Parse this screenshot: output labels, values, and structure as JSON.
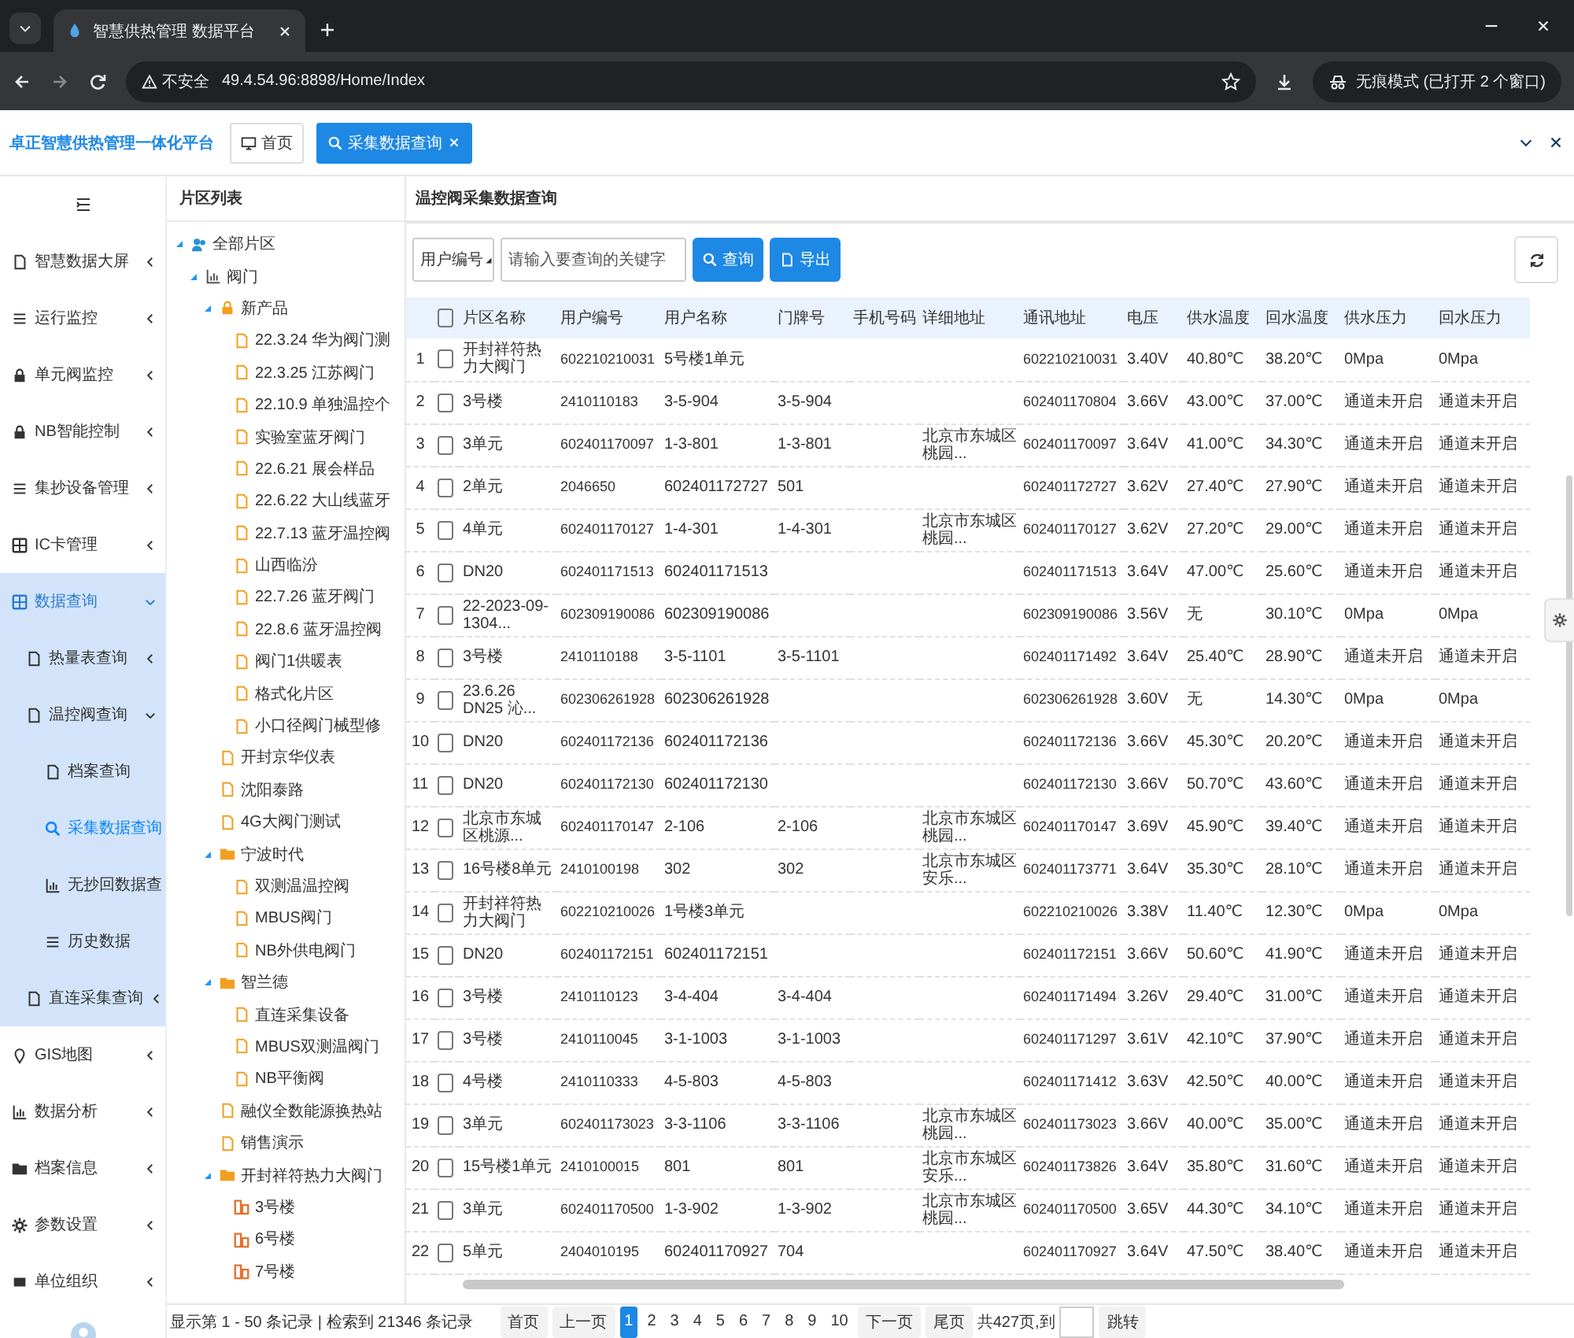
{
  "browser": {
    "tab_title": "智慧供热管理 数据平台",
    "security_label": "不安全",
    "url": "49.4.54.96:8898/Home/Index",
    "profile_label": "无痕模式 (已打开 2 个窗口)"
  },
  "app_header": {
    "brand": "卓正智慧供热管理一体化平台",
    "tabs": [
      {
        "label": "首页",
        "selected": false,
        "closable": false
      },
      {
        "label": "采集数据查询",
        "selected": true,
        "closable": true
      }
    ]
  },
  "sidebar": {
    "items": [
      {
        "label": "智慧数据大屏",
        "selected": false,
        "expanded": false
      },
      {
        "label": "运行监控",
        "selected": false,
        "expanded": false
      },
      {
        "label": "单元阀监控",
        "selected": false,
        "expanded": false
      },
      {
        "label": "NB智能控制",
        "selected": false,
        "expanded": false
      },
      {
        "label": "集抄设备管理",
        "selected": false,
        "expanded": false
      },
      {
        "label": "IC卡管理",
        "selected": false,
        "expanded": false
      },
      {
        "label": "数据查询",
        "selected": false,
        "expanded": true,
        "children": [
          {
            "label": "热量表查询",
            "selected": false,
            "expanded": false
          },
          {
            "label": "温控阀查询",
            "selected": false,
            "expanded": true,
            "children": [
              {
                "label": "档案查询",
                "selected": false
              },
              {
                "label": "采集数据查询",
                "selected": true
              },
              {
                "label": "无抄回数据查",
                "selected": false
              },
              {
                "label": "历史数据",
                "selected": false
              }
            ]
          },
          {
            "label": "直连采集查询",
            "selected": false,
            "expanded": false
          }
        ]
      },
      {
        "label": "GIS地图",
        "selected": false,
        "expanded": false
      },
      {
        "label": "数据分析",
        "selected": false,
        "expanded": false
      },
      {
        "label": "档案信息",
        "selected": false,
        "expanded": false
      },
      {
        "label": "参数设置",
        "selected": false,
        "expanded": false
      },
      {
        "label": "单位组织",
        "selected": false,
        "expanded": false
      }
    ]
  },
  "tree": {
    "title": "片区列表",
    "nodes": [
      {
        "label": "全部片区",
        "kind": "root",
        "expanded": true,
        "children": [
          {
            "label": "阀门",
            "kind": "group",
            "expanded": true,
            "children": [
              {
                "label": "新产品",
                "kind": "locked",
                "expanded": true,
                "children": [
                  {
                    "label": "22.3.24 华为阀门测",
                    "kind": "leaf"
                  },
                  {
                    "label": "22.3.25 江苏阀门",
                    "kind": "leaf"
                  },
                  {
                    "label": "22.10.9 单独温控个",
                    "kind": "leaf"
                  },
                  {
                    "label": "实验室蓝牙阀门",
                    "kind": "leaf"
                  },
                  {
                    "label": "22.6.21 展会样品",
                    "kind": "leaf"
                  },
                  {
                    "label": "22.6.22 大山线蓝牙",
                    "kind": "leaf"
                  },
                  {
                    "label": "22.7.13 蓝牙温控阀",
                    "kind": "leaf"
                  },
                  {
                    "label": "山西临汾",
                    "kind": "leaf"
                  },
                  {
                    "label": "22.7.26 蓝牙阀门",
                    "kind": "leaf"
                  },
                  {
                    "label": "22.8.6 蓝牙温控阀",
                    "kind": "leaf"
                  },
                  {
                    "label": "阀门1供暖表",
                    "kind": "leaf"
                  },
                  {
                    "label": "格式化片区",
                    "kind": "leaf"
                  },
                  {
                    "label": "小口径阀门械型修",
                    "kind": "leaf"
                  }
                ]
              },
              {
                "label": "开封京华仪表",
                "kind": "leaf"
              },
              {
                "label": "沈阳泰路",
                "kind": "leaf"
              },
              {
                "label": "4G大阀门测试",
                "kind": "leaf"
              },
              {
                "label": "宁波时代",
                "kind": "folder",
                "expanded": true,
                "children": [
                  {
                    "label": "双测温温控阀",
                    "kind": "leaf"
                  },
                  {
                    "label": "MBUS阀门",
                    "kind": "leaf"
                  },
                  {
                    "label": "NB外供电阀门",
                    "kind": "leaf"
                  }
                ]
              },
              {
                "label": "智兰德",
                "kind": "folder",
                "expanded": true,
                "children": [
                  {
                    "label": "直连采集设备",
                    "kind": "leaf"
                  },
                  {
                    "label": "MBUS双测温阀门",
                    "kind": "leaf"
                  },
                  {
                    "label": "NB平衡阀",
                    "kind": "leaf"
                  }
                ]
              },
              {
                "label": "融仪全数能源换热站",
                "kind": "leaf"
              },
              {
                "label": "销售演示",
                "kind": "leaf"
              },
              {
                "label": "开封祥符热力大阀门",
                "kind": "folder",
                "expanded": true,
                "children": [
                  {
                    "label": "3号楼",
                    "kind": "building"
                  },
                  {
                    "label": "6号楼",
                    "kind": "building"
                  },
                  {
                    "label": "7号楼",
                    "kind": "building"
                  }
                ]
              }
            ]
          }
        ]
      }
    ]
  },
  "panel": {
    "title": "温控阀采集数据查询",
    "filter_field": "用户编号",
    "search_placeholder": "请输入要查询的关键字",
    "buttons": [
      {
        "label": "查询",
        "kind": "search"
      },
      {
        "label": "导出",
        "kind": "export"
      }
    ]
  },
  "table": {
    "header_checked": false,
    "columns": [
      "片区名称",
      "用户编号",
      "用户名称",
      "门牌号",
      "手机号码",
      "详细地址",
      "通讯地址",
      "电压",
      "供水温度",
      "回水温度",
      "供水压力",
      "回水压力"
    ],
    "rows": [
      {
        "number": "1",
        "checked": false,
        "district": "开封祥符热力大阀门",
        "user_no": "602210210031",
        "user_name": "5号楼1单元",
        "comm_addr": "602210210031",
        "voltage": "3.40V",
        "supply_temp": "40.80℃",
        "return_temp": "38.20℃",
        "supply_pressure": "0Mpa",
        "return_pressure": "0Mpa"
      },
      {
        "number": "2",
        "checked": false,
        "district": "3号楼",
        "user_no": "2410110183",
        "user_name": "3-5-904",
        "door_no": "3-5-904",
        "comm_addr": "602401170804",
        "voltage": "3.66V",
        "supply_temp": "43.00℃",
        "return_temp": "37.00℃",
        "supply_pressure": "通道未开启",
        "return_pressure": "通道未开启"
      },
      {
        "number": "3",
        "checked": false,
        "district": "3单元",
        "user_no": "602401170097",
        "user_name": "1-3-801",
        "door_no": "1-3-801",
        "address": "北京市东城区桃园...",
        "comm_addr": "602401170097",
        "voltage": "3.64V",
        "supply_temp": "41.00℃",
        "return_temp": "34.30℃",
        "supply_pressure": "通道未开启",
        "return_pressure": "通道未开启"
      },
      {
        "number": "4",
        "checked": false,
        "district": "2单元",
        "user_no": "2046650",
        "user_name": "602401172727",
        "door_no": "501",
        "comm_addr": "602401172727",
        "voltage": "3.62V",
        "supply_temp": "27.40℃",
        "return_temp": "27.90℃",
        "supply_pressure": "通道未开启",
        "return_pressure": "通道未开启"
      },
      {
        "number": "5",
        "checked": false,
        "district": "4单元",
        "user_no": "602401170127",
        "user_name": "1-4-301",
        "door_no": "1-4-301",
        "address": "北京市东城区桃园...",
        "comm_addr": "602401170127",
        "voltage": "3.62V",
        "supply_temp": "27.20℃",
        "return_temp": "29.00℃",
        "supply_pressure": "通道未开启",
        "return_pressure": "通道未开启"
      },
      {
        "number": "6",
        "checked": false,
        "district": "DN20",
        "user_no": "602401171513",
        "user_name": "602401171513",
        "comm_addr": "602401171513",
        "voltage": "3.64V",
        "supply_temp": "47.00℃",
        "return_temp": "25.60℃",
        "supply_pressure": "通道未开启",
        "return_pressure": "通道未开启"
      },
      {
        "number": "7",
        "checked": false,
        "district": "22-2023-09-1304...",
        "user_no": "602309190086",
        "user_name": "602309190086",
        "comm_addr": "602309190086",
        "voltage": "3.56V",
        "supply_temp": "无",
        "return_temp": "30.10℃",
        "supply_pressure": "0Mpa",
        "return_pressure": "0Mpa"
      },
      {
        "number": "8",
        "checked": false,
        "district": "3号楼",
        "user_no": "2410110188",
        "user_name": "3-5-1101",
        "door_no": "3-5-1101",
        "comm_addr": "602401171492",
        "voltage": "3.64V",
        "supply_temp": "25.40℃",
        "return_temp": "28.90℃",
        "supply_pressure": "通道未开启",
        "return_pressure": "通道未开启"
      },
      {
        "number": "9",
        "checked": false,
        "district": "23.6.26 DN25 沁...",
        "user_no": "602306261928",
        "user_name": "602306261928",
        "comm_addr": "602306261928",
        "voltage": "3.60V",
        "supply_temp": "无",
        "return_temp": "14.30℃",
        "supply_pressure": "0Mpa",
        "return_pressure": "0Mpa"
      },
      {
        "number": "10",
        "checked": false,
        "district": "DN20",
        "user_no": "602401172136",
        "user_name": "602401172136",
        "comm_addr": "602401172136",
        "voltage": "3.66V",
        "supply_temp": "45.30℃",
        "return_temp": "20.20℃",
        "supply_pressure": "通道未开启",
        "return_pressure": "通道未开启"
      },
      {
        "number": "11",
        "checked": false,
        "district": "DN20",
        "user_no": "602401172130",
        "user_name": "602401172130",
        "comm_addr": "602401172130",
        "voltage": "3.66V",
        "supply_temp": "50.70℃",
        "return_temp": "43.60℃",
        "supply_pressure": "通道未开启",
        "return_pressure": "通道未开启"
      },
      {
        "number": "12",
        "checked": false,
        "district": "北京市东城区桃源...",
        "user_no": "602401170147",
        "user_name": "2-106",
        "door_no": "2-106",
        "address": "北京市东城区桃园...",
        "comm_addr": "602401170147",
        "voltage": "3.69V",
        "supply_temp": "45.90℃",
        "return_temp": "39.40℃",
        "supply_pressure": "通道未开启",
        "return_pressure": "通道未开启"
      },
      {
        "number": "13",
        "checked": false,
        "district": "16号楼8单元",
        "user_no": "2410100198",
        "user_name": "302",
        "door_no": "302",
        "address": "北京市东城区安乐...",
        "comm_addr": "602401173771",
        "voltage": "3.64V",
        "supply_temp": "35.30℃",
        "return_temp": "28.10℃",
        "supply_pressure": "通道未开启",
        "return_pressure": "通道未开启"
      },
      {
        "number": "14",
        "checked": false,
        "district": "开封祥符热力大阀门",
        "user_no": "602210210026",
        "user_name": "1号楼3单元",
        "comm_addr": "602210210026",
        "voltage": "3.38V",
        "supply_temp": "11.40℃",
        "return_temp": "12.30℃",
        "supply_pressure": "0Mpa",
        "return_pressure": "0Mpa"
      },
      {
        "number": "15",
        "checked": false,
        "district": "DN20",
        "user_no": "602401172151",
        "user_name": "602401172151",
        "comm_addr": "602401172151",
        "voltage": "3.66V",
        "supply_temp": "50.60℃",
        "return_temp": "41.90℃",
        "supply_pressure": "通道未开启",
        "return_pressure": "通道未开启"
      },
      {
        "number": "16",
        "checked": false,
        "district": "3号楼",
        "user_no": "2410110123",
        "user_name": "3-4-404",
        "door_no": "3-4-404",
        "comm_addr": "602401171494",
        "voltage": "3.26V",
        "supply_temp": "29.40℃",
        "return_temp": "31.00℃",
        "supply_pressure": "通道未开启",
        "return_pressure": "通道未开启"
      },
      {
        "number": "17",
        "checked": false,
        "district": "3号楼",
        "user_no": "2410110045",
        "user_name": "3-1-1003",
        "door_no": "3-1-1003",
        "comm_addr": "602401171297",
        "voltage": "3.61V",
        "supply_temp": "42.10℃",
        "return_temp": "37.90℃",
        "supply_pressure": "通道未开启",
        "return_pressure": "通道未开启"
      },
      {
        "number": "18",
        "checked": false,
        "district": "4号楼",
        "user_no": "2410110333",
        "user_name": "4-5-803",
        "door_no": "4-5-803",
        "comm_addr": "602401171412",
        "voltage": "3.63V",
        "supply_temp": "42.50℃",
        "return_temp": "40.00℃",
        "supply_pressure": "通道未开启",
        "return_pressure": "通道未开启"
      },
      {
        "number": "19",
        "checked": false,
        "district": "3单元",
        "user_no": "602401173023",
        "user_name": "3-3-1106",
        "door_no": "3-3-1106",
        "address": "北京市东城区桃园...",
        "comm_addr": "602401173023",
        "voltage": "3.66V",
        "supply_temp": "40.00℃",
        "return_temp": "35.00℃",
        "supply_pressure": "通道未开启",
        "return_pressure": "通道未开启"
      },
      {
        "number": "20",
        "checked": false,
        "district": "15号楼1单元",
        "user_no": "2410100015",
        "user_name": "801",
        "door_no": "801",
        "address": "北京市东城区安乐...",
        "comm_addr": "602401173826",
        "voltage": "3.64V",
        "supply_temp": "35.80℃",
        "return_temp": "31.60℃",
        "supply_pressure": "通道未开启",
        "return_pressure": "通道未开启"
      },
      {
        "number": "21",
        "checked": false,
        "district": "3单元",
        "user_no": "602401170500",
        "user_name": "1-3-902",
        "door_no": "1-3-902",
        "address": "北京市东城区桃园...",
        "comm_addr": "602401170500",
        "voltage": "3.65V",
        "supply_temp": "44.30℃",
        "return_temp": "34.10℃",
        "supply_pressure": "通道未开启",
        "return_pressure": "通道未开启"
      },
      {
        "number": "22",
        "checked": false,
        "district": "5单元",
        "user_no": "2404010195",
        "user_name": "602401170927",
        "door_no": "704",
        "comm_addr": "602401170927",
        "voltage": "3.64V",
        "supply_temp": "47.50℃",
        "return_temp": "38.40℃",
        "supply_pressure": "通道未开启",
        "return_pressure": "通道未开启"
      }
    ]
  },
  "footer": {
    "summary": "显示第 1 - 50 条记录 | 检索到 21346 条记录",
    "nav_before": [
      "首页",
      "上一页"
    ],
    "pages": [
      {
        "label": "1",
        "selected": true
      },
      {
        "label": "2",
        "selected": false
      },
      {
        "label": "3",
        "selected": false
      },
      {
        "label": "4",
        "selected": false
      },
      {
        "label": "5",
        "selected": false
      },
      {
        "label": "6",
        "selected": false
      },
      {
        "label": "7",
        "selected": false
      },
      {
        "label": "8",
        "selected": false
      },
      {
        "label": "9",
        "selected": false
      },
      {
        "label": "10",
        "selected": false
      }
    ],
    "nav_after": [
      "下一页",
      "尾页"
    ],
    "jump_label": "共427页,到",
    "jump_button": "跳转"
  }
}
